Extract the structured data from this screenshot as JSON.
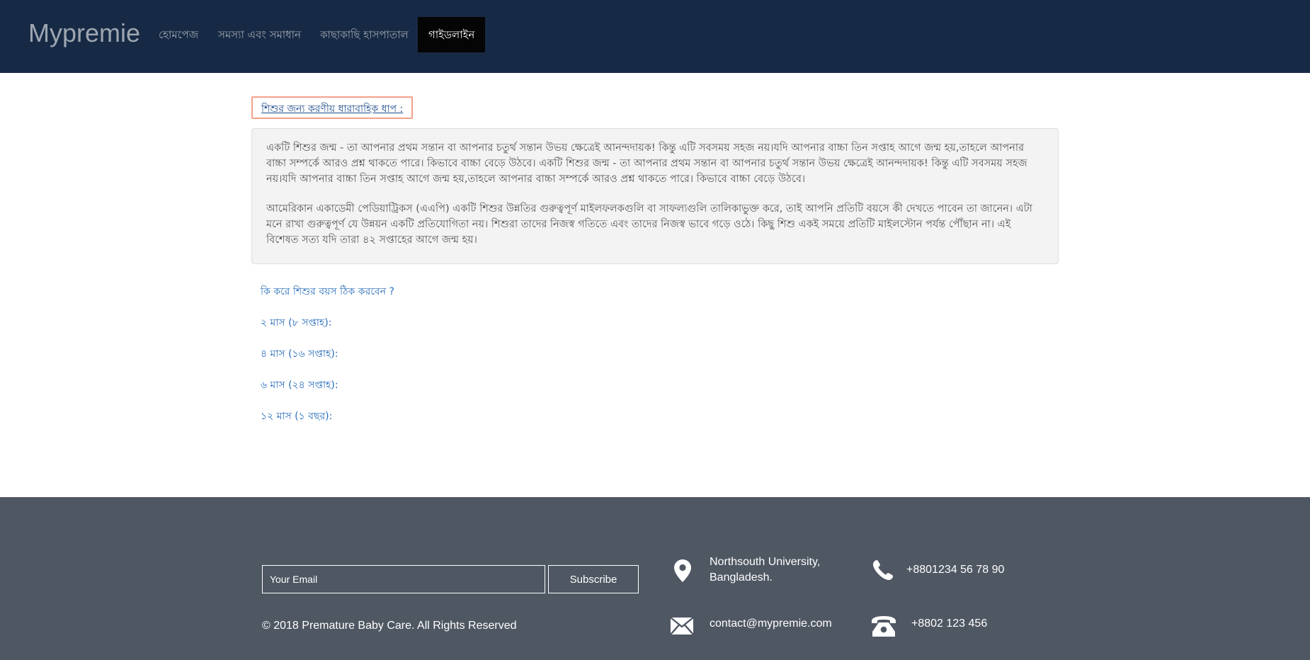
{
  "nav": {
    "brand": "Mypremie",
    "items": [
      {
        "label": "হোমপেজ"
      },
      {
        "label": "সমস্যা এবং সমাধান"
      },
      {
        "label": "কাছাকাছি হাসপাতাল"
      },
      {
        "label": "গাইডলাইন",
        "active": true
      }
    ]
  },
  "main": {
    "section_title": "শিশুর জন্য করণীয় ধারাবাহিক ধাপ :",
    "paragraphs": [
      "একটি শিশুর জন্ম - তা আপনার প্রথম সন্তান বা আপনার চতুর্থ সন্তান উভয় ক্ষেত্রেই আনন্দদায়ক! কিন্তু এটি সবসময় সহজ নয়।যদি আপনার বাচ্চা তিন সপ্তাহ আগে জন্ম হয়,তাহলে আপনার বাচ্চা সম্পর্কে আরও প্রশ্ন থাকতে পারে। কিভাবে বাচ্চা বেড়ে উঠবে। একটি শিশুর জন্ম - তা আপনার প্রথম সন্তান বা আপনার চতুর্থ সন্তান উভয় ক্ষেত্রেই আনন্দদায়ক! কিন্তু এটি সবসময় সহজ নয়।যদি আপনার বাচ্চা তিন সপ্তাহ আগে জন্ম হয়,তাহলে আপনার বাচ্চা সম্পর্কে আরও প্রশ্ন থাকতে পারে। কিভাবে বাচ্চা বেড়ে উঠবে।",
      "আমেরিকান একাডেমী পেডিয়াট্রিকস (এএপি) একটি শিশুর উন্নতির গুরুত্বপূর্ণ মাইলফলকগুলি বা সাফল্যগুলি তালিকাভুক্ত করে, তাই আপনি প্রতিটি বয়সে কী দেখতে পাবেন তা জানেন। এটা মনে রাখা গুরুত্বপূর্ণ যে উন্নয়ন একটি প্রতিযোগিতা নয়। শিশুরা তাদের নিজস্ব গতিতে এবং তাদের নিজস্ব ভাবে গড়ে ওঠে। কিছু শিশু একই সময়ে প্রতিটি মাইলস্টোন পর্যন্ত পৌঁছান না। এই বিশেষত সত্য যদি তারা ৪২ সপ্তাহের আগে জন্ম হয়।"
    ],
    "links": [
      "কি করে শিশুর বয়স ঠিক করবেন ?",
      "২ মাস (৮ সপ্তাহ):",
      "৪ মাস (১৬ সপ্তাহ):",
      "৬ মাস (২৪ সপ্তাহ):",
      "১২ মাস (১ বছর):"
    ]
  },
  "footer": {
    "email_placeholder": "Your Email",
    "subscribe_label": "Subscribe",
    "copyright": "© 2018 Premature Baby Care. All Rights Reserved",
    "address_line1": "Northsouth University,",
    "address_line2": "Bangladesh.",
    "phone_mobile": "+8801234 56 78 90",
    "email": "contact@mypremie.com",
    "phone_landline": "+8802 123 456",
    "icons": {
      "address": "map-pin-icon",
      "mobile": "phone-icon",
      "email": "envelope-icon",
      "landline": "telephone-icon"
    }
  },
  "colors": {
    "navbar_bg": "#172a45",
    "active_nav_bg": "#050505",
    "link_blue": "#2a6ebb",
    "title_border": "#f4a18c",
    "footer_bg": "#4f5763",
    "intro_bg": "#f3f3f3"
  }
}
